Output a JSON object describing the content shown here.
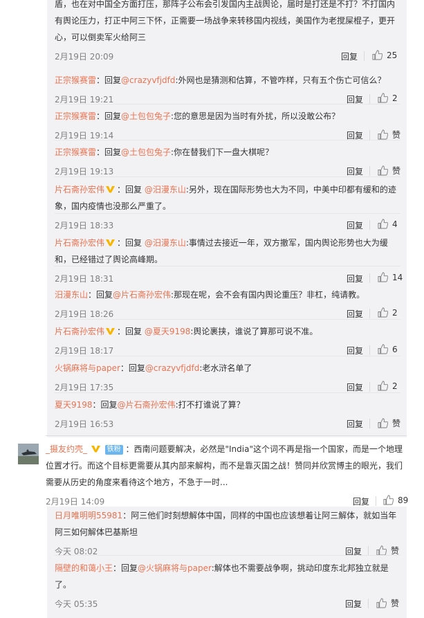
{
  "top_fragment": {
    "line1": "盾，也在对中国全方面打压，那阵子公布会引发国内主战舆论，届时是打还是不打？不打国内",
    "line2": "有舆论压力，打正中阿三下怀，正需要一场战争来转移国内视线，美国作为老搅屎棍子，更开",
    "line3": "心，可以倒卖军火给阿三",
    "time": "2月19日 20:09",
    "reply_label": "回复",
    "likes": "25"
  },
  "replies": [
    {
      "user": "正宗猴赛雷",
      "verified": false,
      "prefix": "：回复",
      "mention": "@crazyvfjdfd",
      "text": ":外网也是猜测和估算，不管咋样，只有五个伤亡可信么？",
      "time": "2月19日 19:21",
      "reply_label": "回复",
      "likes": "2"
    },
    {
      "user": "正宗猴赛雷",
      "verified": false,
      "prefix": "：回复",
      "mention": "@土包包兔子",
      "text": ":您的意思是因为当时有外扰，所以没敢公布？",
      "time": "2月19日 19:14",
      "reply_label": "回复",
      "likes": "赞"
    },
    {
      "user": "正宗猴赛雷",
      "verified": false,
      "prefix": "：回复",
      "mention": "@土包包兔子",
      "text": ":你在替我们下一盘大棋呢？",
      "time": "2月19日 19:13",
      "reply_label": "回复",
      "likes": "赞"
    },
    {
      "user": "片石斋孙宏伟",
      "verified": true,
      "prefix": "：回复 ",
      "mention": "@汨漫东山",
      "text": ":另外，现在国际形势也大为不同，中美中印都有缓和的迹象，国内疫情也没那么严重了。",
      "time": "2月19日 18:33",
      "reply_label": "回复",
      "likes": "4"
    },
    {
      "user": "片石斋孙宏伟",
      "verified": true,
      "prefix": "：回复 ",
      "mention": "@汨漫东山",
      "text": ":事情过去接近一年，双方撤军，国内舆论形势也大为缓和，已经错过了舆论高峰期。",
      "time": "2月19日 18:31",
      "reply_label": "回复",
      "likes": "14"
    },
    {
      "user": "汨漫东山",
      "verified": false,
      "prefix": "：回复",
      "mention": "@片石斋孙宏伟",
      "text": ":那现在呢，会不会有国内舆论重压？非杠，纯请教。",
      "time": "2月19日 18:26",
      "reply_label": "回复",
      "likes": "2"
    },
    {
      "user": "片石斋孙宏伟",
      "verified": true,
      "prefix": "：回复 ",
      "mention": "@夏天9198",
      "text": ":舆论裹挟，谁说了算那可说不准。",
      "time": "2月19日 18:17",
      "reply_label": "回复",
      "likes": "6"
    },
    {
      "user": "火锅麻将与paper",
      "verified": false,
      "prefix": "：回复",
      "mention": "@crazyvfjdfd",
      "text": ":老水浒名单了",
      "time": "2月19日 17:35",
      "reply_label": "回复",
      "likes": "2"
    },
    {
      "user": "夏天9198",
      "verified": false,
      "prefix": "：回复",
      "mention": "@片石斋孙宏伟",
      "text": ":打不打谁说了算？",
      "time": "2月19日 16:53",
      "reply_label": "回复",
      "likes": "赞"
    }
  ],
  "main_comment": {
    "user": "_摄友约壳_",
    "badge": "铁粉",
    "text": "：西南问题要解决，必然是\"India\"这个词不再是指一个国家，而是一个地理位置才行。而这个目标更需要从其内部来解构，而不是靠灭国之战！赞同并欣赏博主的眼光，我们需要从历史的角度来看待这个地方，不急于一时...",
    "time": "2月19日 14:09",
    "reply_label": "回复",
    "likes": "89"
  },
  "sub_replies": [
    {
      "user": "日月唯明明55981",
      "prefix": "：",
      "mention": "",
      "text": "阿三他们时刻想解体中国，同样的中国也应该想着让阿三解体，就如当年阿三如何解体巴基斯坦",
      "time": "今天 08:02",
      "reply_label": "回复",
      "likes": "赞"
    },
    {
      "user": "隔壁的和蔼小王",
      "prefix": "：回复",
      "mention": "@火锅麻将与paper",
      "text": ":解体也不需要战争啊，挑动印度东北邦独立就是了。",
      "time": "今天 05:35",
      "reply_label": "回复",
      "likes": "赞"
    }
  ],
  "colors": {
    "accent": "#eb7350",
    "panel_bg": "#f2f2f5",
    "time_gray": "#808080",
    "verified": "#f7b500",
    "badge_blue": "#6cb6f0"
  },
  "icons": [
    "thumb-up-icon",
    "verified-v-icon",
    "avatar-image"
  ]
}
